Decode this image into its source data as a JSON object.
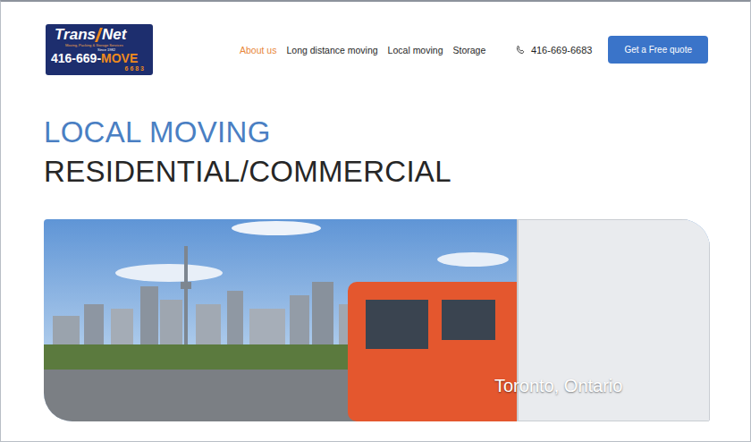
{
  "logo": {
    "brand_left": "Trans",
    "brand_right": "Net",
    "tagline": "Moving, Packing & Storage Services",
    "since": "Since 1982",
    "phone_prefix": "416-669-",
    "phone_word": "MOVE",
    "phone_digits": "6 6 8 3"
  },
  "nav": [
    {
      "label": "About us",
      "selected": true
    },
    {
      "label": "Long distance moving",
      "selected": false
    },
    {
      "label": "Local moving",
      "selected": false
    },
    {
      "label": "Storage",
      "selected": false
    }
  ],
  "phone": {
    "number": "416-669-6683"
  },
  "cta": {
    "label": "Get a Free quote"
  },
  "hero": {
    "title": "LOCAL MOVING",
    "subtitle": "RESIDENTIAL/COMMERCIAL",
    "caption": "Toronto, Ontario"
  }
}
